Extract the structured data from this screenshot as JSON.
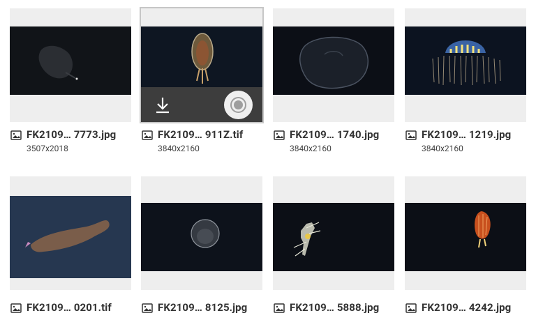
{
  "files": [
    {
      "name": "FK2109… 7773.jpg",
      "dims": "3507x2018"
    },
    {
      "name": "FK2109… 911Z.tif",
      "dims": "3840x2160"
    },
    {
      "name": "FK2109… 1740.jpg",
      "dims": "3840x2160"
    },
    {
      "name": "FK2109… 1219.jpg",
      "dims": "3840x2160"
    },
    {
      "name": "FK2109… 0201.tif",
      "dims": ""
    },
    {
      "name": "FK2109… 8125.jpg",
      "dims": ""
    },
    {
      "name": "FK2109… 5888.jpg",
      "dims": ""
    },
    {
      "name": "FK2109… 4242.jpg",
      "dims": ""
    }
  ],
  "selected_index": 1,
  "actions": {
    "download_icon": "download-icon",
    "record_icon": "record-icon"
  },
  "icons": {
    "file_type": "image-icon"
  },
  "colors": {
    "tile_bg": "#eeeeee",
    "action_bar": "#3d3d3d",
    "deep_sea": "#0c0f16",
    "text": "#333333"
  }
}
